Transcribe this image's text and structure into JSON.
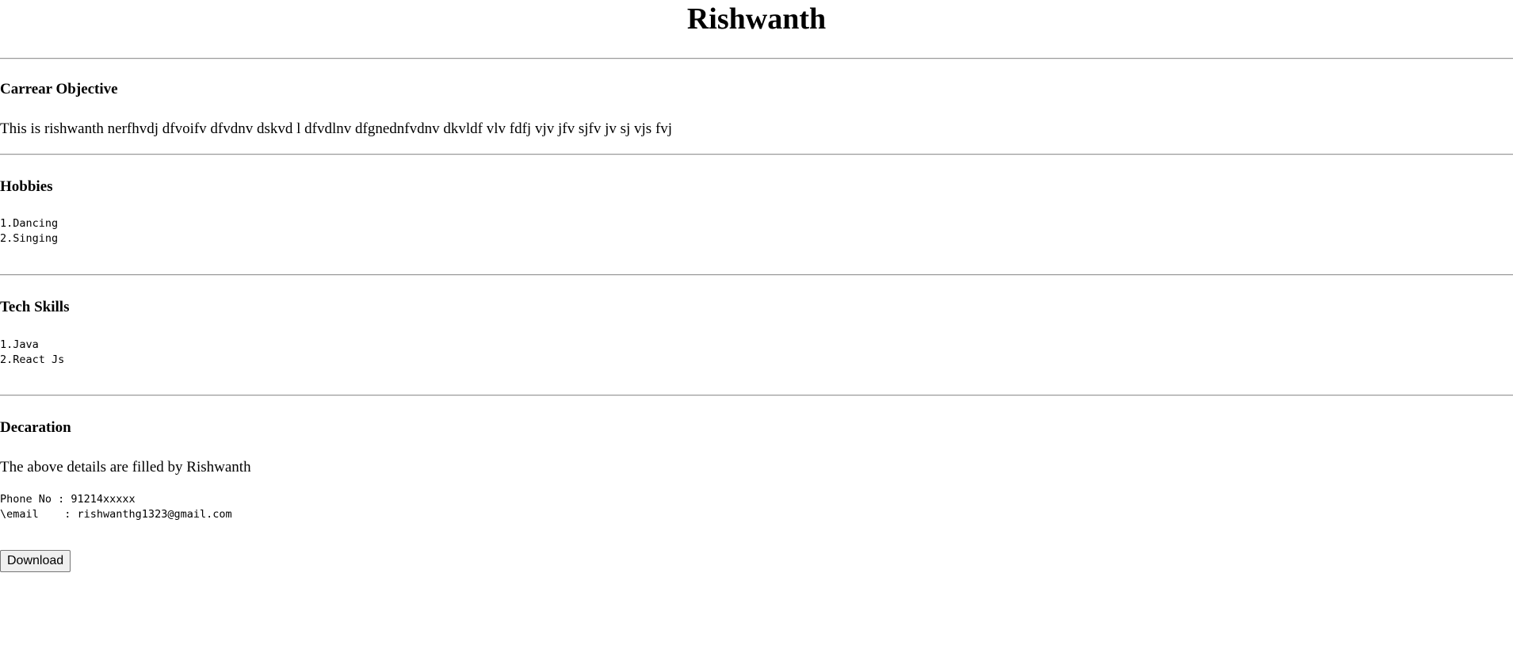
{
  "header": {
    "name": "Rishwanth"
  },
  "objective": {
    "title": "Carrear Objective",
    "text": "This is rishwanth nerfhvdj dfvoifv dfvdnv dskvd l dfvdlnv dfgnednfvdnv dkvldf vlv fdfj vjv jfv sjfv jv sj vjs fvj"
  },
  "hobbies": {
    "title": "Hobbies",
    "items": [
      "1.Dancing",
      "2.Singing"
    ]
  },
  "tech_skills": {
    "title": "Tech Skills",
    "items": [
      "1.Java",
      "2.React Js"
    ]
  },
  "declaration": {
    "title": "Decaration",
    "text": "The above details are filled by Rishwanth",
    "contact": [
      "Phone No : 91214xxxxx",
      "\\email    : rishwanthg1323@gmail.com"
    ]
  },
  "actions": {
    "download_label": "Download"
  }
}
